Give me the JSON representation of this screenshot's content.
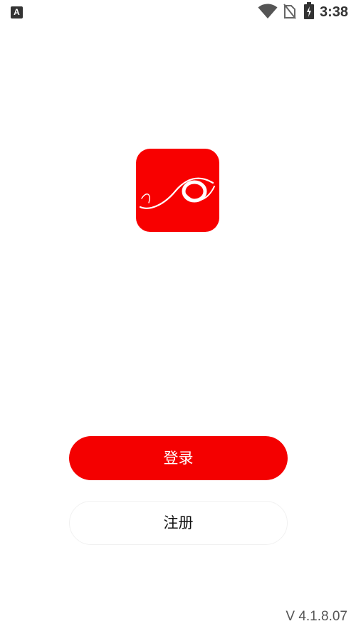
{
  "status_bar": {
    "left_icon_letter": "A",
    "left_icon": "keyboard-a-icon",
    "wifi_icon": "wifi-icon",
    "sim_icon": "no-sim-icon",
    "battery_icon": "battery-charging-icon",
    "time": "3:38"
  },
  "logo": {
    "icon": "app-logo-icon",
    "background_color": "#f80000"
  },
  "actions": {
    "login_label": "登录",
    "register_label": "注册",
    "login_color": "#f40000"
  },
  "footer": {
    "version": "V 4.1.8.07"
  }
}
